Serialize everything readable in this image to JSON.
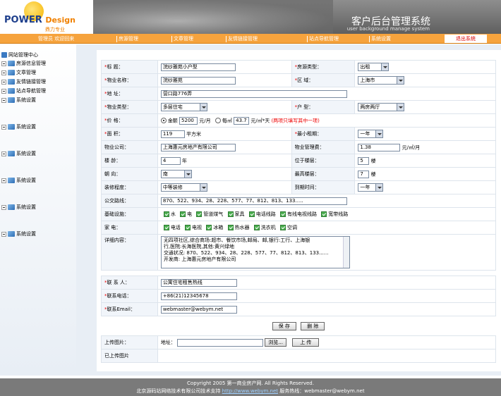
{
  "header": {
    "logo_text": "POWER",
    "logo_text2": "Design",
    "logo_sub": "鼎力专业",
    "title": "客户后台管理系统",
    "subtitle": "user background manage system"
  },
  "nav": {
    "welcome": "管理员 欢迎回来",
    "items": [
      "房源管理",
      "文章管理",
      "友情链接管理",
      "站点导航管理",
      "系统设置"
    ],
    "logout": "退出系统"
  },
  "sidebar": {
    "root": "网站管理中心",
    "items": [
      "房源信息管理",
      "文章管理",
      "友情链接管理",
      "站点导航管理",
      "系统设置"
    ],
    "system_items": [
      "系统设置",
      "系统设置",
      "系统设置",
      "系统设置",
      "系统设置"
    ]
  },
  "form": {
    "title_label": "标  题：",
    "title_value": "浣纱雅苑小户型",
    "type_label": "房源类型：",
    "type_value": "出租",
    "property_name_label": "物业名称：",
    "property_name_value": "浣纱雅苑",
    "district_label": "区  域：",
    "district_value": "上海市",
    "address_label": "地  址：",
    "address_value": "营口路776弄",
    "property_type_label": "物业类型：",
    "property_type_value": "多层住宅",
    "layout_label": "户  型：",
    "layout_value": "两房两厅",
    "price_label": "价  格：",
    "price_total_label": "金额",
    "price_total_value": "5200",
    "price_total_unit": "元/月",
    "price_per_label": "每㎡",
    "price_per_value": "43.7",
    "price_per_unit": "元/㎡*天",
    "price_hint": "(两项只填写其中一项)",
    "area_label": "面  积：",
    "area_value": "119",
    "area_unit": "平方米",
    "min_rent_label": "最小租期：",
    "min_rent_value": "一年",
    "company_label": "物业公司：",
    "company_value": "上海惠元房地产有限公司",
    "fee_label": "物业管理费：",
    "fee_value": "1.38",
    "fee_unit": "元/㎡/月",
    "age_label": "楼  龄：",
    "age_value": "4",
    "age_unit": "年",
    "floor_label": "位于楼层：",
    "floor_value": "5",
    "floor_unit": "楼",
    "facing_label": "朝  向：",
    "facing_value": "南",
    "top_floor_label": "最高楼层：",
    "top_floor_value": "7",
    "top_floor_unit": "楼",
    "decor_label": "装修程度：",
    "decor_value": "中等装修",
    "arrive_label": "到期时间：",
    "arrive_value": "一年",
    "bus_label": "公交路线：",
    "bus_value": "870、522、934、28、228、577、77、812、813、133.....",
    "facilities_label": "基础设施：",
    "facilities": [
      "水",
      "电",
      "管道煤气",
      "家具",
      "电话线路",
      "有线电视线路",
      "宽带线路"
    ],
    "appliances_label": "家  电：",
    "appliances": [
      "电话",
      "电视",
      "冰箱",
      "热水器",
      "洗衣机",
      "空调"
    ],
    "detail_label": "详细内容：",
    "detail_lines": [
      "无四项社区,综合商场:超市、餐饮市场,邮局、邮,银行:工行、上海银",
      "行,医院:长海医院,其他:黄兴绿地",
      "交通状况: 870、522、934、28、228、577、77、812、813、133......",
      "开发商: 上海惠元房地产有限公司"
    ],
    "contact_label": "联 系 人：",
    "contact_value": "公寓住宅租售热线",
    "phone_label": "联系电话：",
    "phone_value": "+86(21)12345678",
    "email_label": "联系Email：",
    "email_value": "webmaster@webym.net",
    "save_button": "保 存",
    "delete_button": "删 除",
    "upload_label": "上传图片：",
    "upload_addr_label": "地址：",
    "browse_button": "浏览...",
    "upload_button": "上 传",
    "uploaded_label": "已上传图片"
  },
  "footer": {
    "line1": "Copyright 2005 第一商业房产网. All Rights Reserved.",
    "line2_prefix": "北京源码站网络技术有限公司技术支持",
    "line2_link": "http://www.webym.net",
    "line2_suffix": "服务热线：webmaster@webym.net"
  }
}
